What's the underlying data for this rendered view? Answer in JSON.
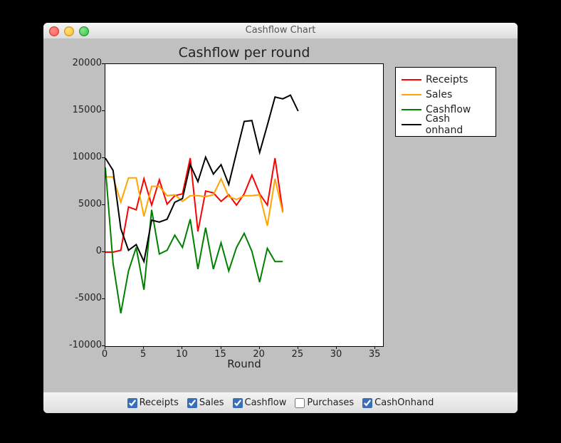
{
  "window": {
    "title": "Cashflow Chart"
  },
  "chart_data": {
    "type": "line",
    "title": "Cashflow per round",
    "xlabel": "Round",
    "ylabel": "",
    "xlim": [
      0,
      36
    ],
    "ylim": [
      -10000,
      20000
    ],
    "xticks": [
      0,
      5,
      10,
      15,
      20,
      25,
      30,
      35
    ],
    "yticks": [
      -10000,
      -5000,
      0,
      5000,
      10000,
      15000,
      20000
    ],
    "x": [
      0,
      1,
      2,
      3,
      4,
      5,
      6,
      7,
      8,
      9,
      10,
      11,
      12,
      13,
      14,
      15,
      16,
      17,
      18,
      19,
      20,
      21,
      22,
      23,
      24,
      25
    ],
    "series": [
      {
        "name": "Receipts",
        "color": "#ff0000",
        "values": [
          0,
          0,
          200,
          4800,
          4500,
          7800,
          5000,
          7700,
          5100,
          6000,
          6200,
          10000,
          2200,
          6500,
          6300,
          5400,
          6100,
          5000,
          6200,
          8200,
          6200,
          5000,
          10000,
          4300,
          null,
          null
        ]
      },
      {
        "name": "Sales",
        "color": "#ffa500",
        "values": [
          8000,
          8000,
          5300,
          7900,
          7900,
          3800,
          7000,
          7000,
          6000,
          6100,
          5400,
          6000,
          6000,
          5900,
          6100,
          7800,
          5900,
          5600,
          6000,
          6000,
          6100,
          2800,
          7800,
          4200,
          null,
          null
        ]
      },
      {
        "name": "Cashflow",
        "color": "#008000",
        "values": [
          9000,
          -1200,
          -6500,
          -2000,
          500,
          -4000,
          4500,
          -200,
          200,
          1800,
          500,
          3500,
          -1800,
          2600,
          -1800,
          1000,
          -2000,
          500,
          2000,
          100,
          -3200,
          400,
          -1000,
          -1000,
          null,
          null
        ]
      },
      {
        "name": "Cash onhand",
        "color": "#000000",
        "values": [
          10000,
          8700,
          2500,
          200,
          800,
          -1000,
          3400,
          3200,
          3500,
          5300,
          5700,
          9300,
          7500,
          10100,
          8300,
          9300,
          7200,
          10600,
          13900,
          14000,
          10600,
          13500,
          16500,
          16300,
          16700,
          15000
        ]
      }
    ],
    "legend_position": "upper right outside"
  },
  "legend": {
    "items": [
      {
        "label": "Receipts",
        "color": "#ff0000"
      },
      {
        "label": "Sales",
        "color": "#ffa500"
      },
      {
        "label": "Cashflow",
        "color": "#008000"
      },
      {
        "label": "Cash onhand",
        "color": "#000000"
      }
    ]
  },
  "toolbar": {
    "checkboxes": [
      {
        "name": "receipts",
        "label": "Receipts",
        "checked": true
      },
      {
        "name": "sales",
        "label": "Sales",
        "checked": true
      },
      {
        "name": "cashflow",
        "label": "Cashflow",
        "checked": true
      },
      {
        "name": "purchases",
        "label": "Purchases",
        "checked": false
      },
      {
        "name": "cashonhand",
        "label": "CashOnhand",
        "checked": true
      }
    ]
  }
}
